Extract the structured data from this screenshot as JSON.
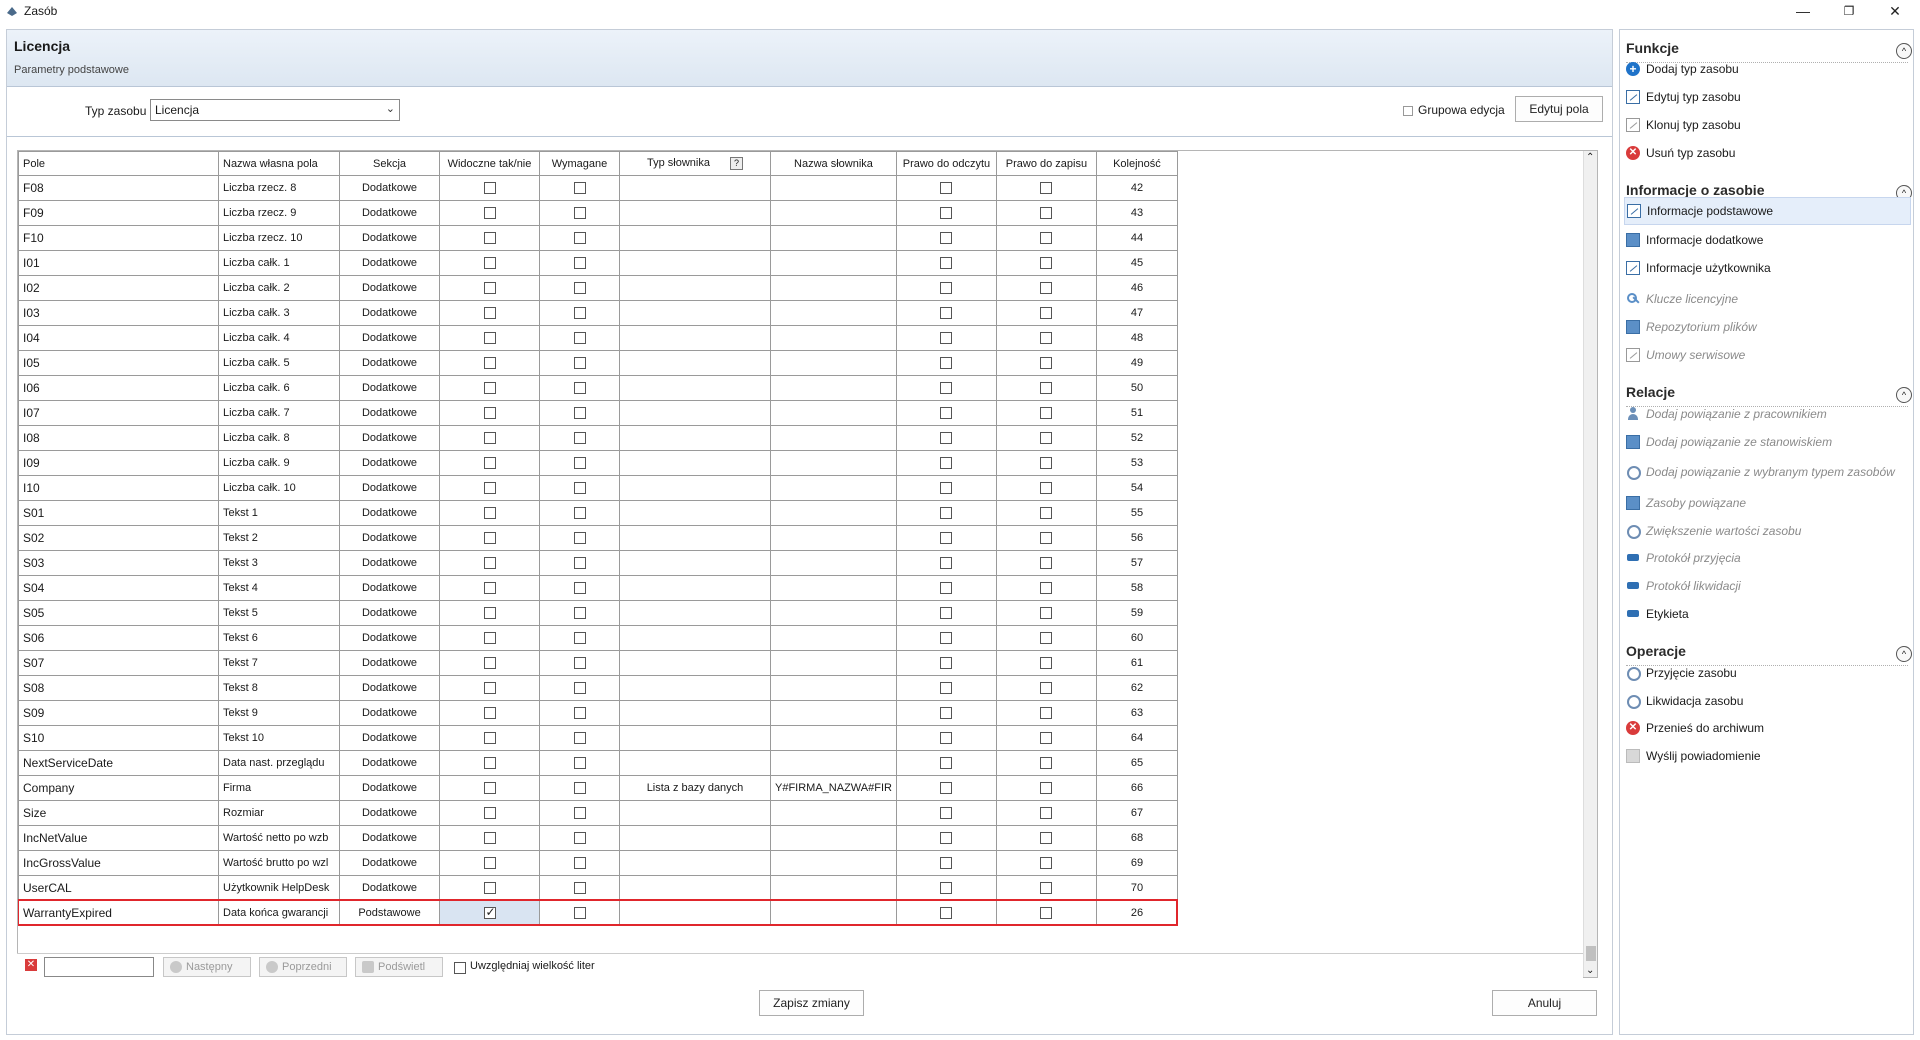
{
  "window": {
    "title": "Zasób",
    "minimize": "—",
    "restore": "❐",
    "close": "✕"
  },
  "header": {
    "title": "Licencja",
    "subtitle": "Parametry podstawowe"
  },
  "toolbar": {
    "typ_label": "Typ zasobu",
    "typ_value": "Licencja",
    "group_edit_label": "Grupowa edycja",
    "edit_fields_button": "Edytuj pola"
  },
  "grid": {
    "columns": [
      "Pole",
      "Nazwa własna pola",
      "Sekcja",
      "Widoczne tak/nie",
      "Wymagane",
      "Typ słownika",
      "Nazwa słownika",
      "Prawo do odczytu",
      "Prawo do zapisu",
      "Kolejność"
    ],
    "help_mark": "?",
    "rows": [
      {
        "pole": "F08",
        "nazwa": "Liczba rzecz. 8",
        "sekcja": "Dodatkowe",
        "widoczne": false,
        "wymagane": false,
        "typ": "",
        "slownik": "",
        "odczyt": false,
        "zapis": false,
        "kolejnosc": "42"
      },
      {
        "pole": "F09",
        "nazwa": "Liczba rzecz. 9",
        "sekcja": "Dodatkowe",
        "widoczne": false,
        "wymagane": false,
        "typ": "",
        "slownik": "",
        "odczyt": false,
        "zapis": false,
        "kolejnosc": "43"
      },
      {
        "pole": "F10",
        "nazwa": "Liczba rzecz. 10",
        "sekcja": "Dodatkowe",
        "widoczne": false,
        "wymagane": false,
        "typ": "",
        "slownik": "",
        "odczyt": false,
        "zapis": false,
        "kolejnosc": "44"
      },
      {
        "pole": "I01",
        "nazwa": "Liczba całk. 1",
        "sekcja": "Dodatkowe",
        "widoczne": false,
        "wymagane": false,
        "typ": "",
        "slownik": "",
        "odczyt": false,
        "zapis": false,
        "kolejnosc": "45"
      },
      {
        "pole": "I02",
        "nazwa": "Liczba całk. 2",
        "sekcja": "Dodatkowe",
        "widoczne": false,
        "wymagane": false,
        "typ": "",
        "slownik": "",
        "odczyt": false,
        "zapis": false,
        "kolejnosc": "46"
      },
      {
        "pole": "I03",
        "nazwa": "Liczba całk. 3",
        "sekcja": "Dodatkowe",
        "widoczne": false,
        "wymagane": false,
        "typ": "",
        "slownik": "",
        "odczyt": false,
        "zapis": false,
        "kolejnosc": "47"
      },
      {
        "pole": "I04",
        "nazwa": "Liczba całk. 4",
        "sekcja": "Dodatkowe",
        "widoczne": false,
        "wymagane": false,
        "typ": "",
        "slownik": "",
        "odczyt": false,
        "zapis": false,
        "kolejnosc": "48"
      },
      {
        "pole": "I05",
        "nazwa": "Liczba całk. 5",
        "sekcja": "Dodatkowe",
        "widoczne": false,
        "wymagane": false,
        "typ": "",
        "slownik": "",
        "odczyt": false,
        "zapis": false,
        "kolejnosc": "49"
      },
      {
        "pole": "I06",
        "nazwa": "Liczba całk. 6",
        "sekcja": "Dodatkowe",
        "widoczne": false,
        "wymagane": false,
        "typ": "",
        "slownik": "",
        "odczyt": false,
        "zapis": false,
        "kolejnosc": "50"
      },
      {
        "pole": "I07",
        "nazwa": "Liczba całk. 7",
        "sekcja": "Dodatkowe",
        "widoczne": false,
        "wymagane": false,
        "typ": "",
        "slownik": "",
        "odczyt": false,
        "zapis": false,
        "kolejnosc": "51"
      },
      {
        "pole": "I08",
        "nazwa": "Liczba całk. 8",
        "sekcja": "Dodatkowe",
        "widoczne": false,
        "wymagane": false,
        "typ": "",
        "slownik": "",
        "odczyt": false,
        "zapis": false,
        "kolejnosc": "52"
      },
      {
        "pole": "I09",
        "nazwa": "Liczba całk. 9",
        "sekcja": "Dodatkowe",
        "widoczne": false,
        "wymagane": false,
        "typ": "",
        "slownik": "",
        "odczyt": false,
        "zapis": false,
        "kolejnosc": "53"
      },
      {
        "pole": "I10",
        "nazwa": "Liczba całk. 10",
        "sekcja": "Dodatkowe",
        "widoczne": false,
        "wymagane": false,
        "typ": "",
        "slownik": "",
        "odczyt": false,
        "zapis": false,
        "kolejnosc": "54"
      },
      {
        "pole": "S01",
        "nazwa": "Tekst 1",
        "sekcja": "Dodatkowe",
        "widoczne": false,
        "wymagane": false,
        "typ": "",
        "slownik": "",
        "odczyt": false,
        "zapis": false,
        "kolejnosc": "55"
      },
      {
        "pole": "S02",
        "nazwa": "Tekst 2",
        "sekcja": "Dodatkowe",
        "widoczne": false,
        "wymagane": false,
        "typ": "",
        "slownik": "",
        "odczyt": false,
        "zapis": false,
        "kolejnosc": "56"
      },
      {
        "pole": "S03",
        "nazwa": "Tekst 3",
        "sekcja": "Dodatkowe",
        "widoczne": false,
        "wymagane": false,
        "typ": "",
        "slownik": "",
        "odczyt": false,
        "zapis": false,
        "kolejnosc": "57"
      },
      {
        "pole": "S04",
        "nazwa": "Tekst 4",
        "sekcja": "Dodatkowe",
        "widoczne": false,
        "wymagane": false,
        "typ": "",
        "slownik": "",
        "odczyt": false,
        "zapis": false,
        "kolejnosc": "58"
      },
      {
        "pole": "S05",
        "nazwa": "Tekst 5",
        "sekcja": "Dodatkowe",
        "widoczne": false,
        "wymagane": false,
        "typ": "",
        "slownik": "",
        "odczyt": false,
        "zapis": false,
        "kolejnosc": "59"
      },
      {
        "pole": "S06",
        "nazwa": "Tekst 6",
        "sekcja": "Dodatkowe",
        "widoczne": false,
        "wymagane": false,
        "typ": "",
        "slownik": "",
        "odczyt": false,
        "zapis": false,
        "kolejnosc": "60"
      },
      {
        "pole": "S07",
        "nazwa": "Tekst 7",
        "sekcja": "Dodatkowe",
        "widoczne": false,
        "wymagane": false,
        "typ": "",
        "slownik": "",
        "odczyt": false,
        "zapis": false,
        "kolejnosc": "61"
      },
      {
        "pole": "S08",
        "nazwa": "Tekst 8",
        "sekcja": "Dodatkowe",
        "widoczne": false,
        "wymagane": false,
        "typ": "",
        "slownik": "",
        "odczyt": false,
        "zapis": false,
        "kolejnosc": "62"
      },
      {
        "pole": "S09",
        "nazwa": "Tekst 9",
        "sekcja": "Dodatkowe",
        "widoczne": false,
        "wymagane": false,
        "typ": "",
        "slownik": "",
        "odczyt": false,
        "zapis": false,
        "kolejnosc": "63"
      },
      {
        "pole": "S10",
        "nazwa": "Tekst 10",
        "sekcja": "Dodatkowe",
        "widoczne": false,
        "wymagane": false,
        "typ": "",
        "slownik": "",
        "odczyt": false,
        "zapis": false,
        "kolejnosc": "64"
      },
      {
        "pole": "NextServiceDate",
        "nazwa": "Data nast. przeglądu",
        "sekcja": "Dodatkowe",
        "widoczne": false,
        "wymagane": false,
        "typ": "",
        "slownik": "",
        "odczyt": false,
        "zapis": false,
        "kolejnosc": "65"
      },
      {
        "pole": "Company",
        "nazwa": "Firma",
        "sekcja": "Dodatkowe",
        "widoczne": false,
        "wymagane": false,
        "typ": "Lista z bazy danych",
        "slownik": "Y#FIRMA_NAZWA#FIR",
        "odczyt": false,
        "zapis": false,
        "kolejnosc": "66"
      },
      {
        "pole": "Size",
        "nazwa": "Rozmiar",
        "sekcja": "Dodatkowe",
        "widoczne": false,
        "wymagane": false,
        "typ": "",
        "slownik": "",
        "odczyt": false,
        "zapis": false,
        "kolejnosc": "67"
      },
      {
        "pole": "IncNetValue",
        "nazwa": "Wartość netto po wzb",
        "sekcja": "Dodatkowe",
        "widoczne": false,
        "wymagane": false,
        "typ": "",
        "slownik": "",
        "odczyt": false,
        "zapis": false,
        "kolejnosc": "68"
      },
      {
        "pole": "IncGrossValue",
        "nazwa": "Wartość brutto po wzl",
        "sekcja": "Dodatkowe",
        "widoczne": false,
        "wymagane": false,
        "typ": "",
        "slownik": "",
        "odczyt": false,
        "zapis": false,
        "kolejnosc": "69"
      },
      {
        "pole": "UserCAL",
        "nazwa": "Użytkownik HelpDesk",
        "sekcja": "Dodatkowe",
        "widoczne": false,
        "wymagane": false,
        "typ": "",
        "slownik": "",
        "odczyt": false,
        "zapis": false,
        "kolejnosc": "70"
      },
      {
        "pole": "WarrantyExpired",
        "nazwa": "Data końca gwarancji",
        "sekcja": "Podstawowe",
        "widoczne": true,
        "wymagane": false,
        "typ": "",
        "slownik": "",
        "odczyt": false,
        "zapis": false,
        "kolejnosc": "26"
      }
    ]
  },
  "findbar": {
    "close": "✕",
    "next": "Następny",
    "prev": "Poprzedni",
    "highlight": "Podświetl",
    "case_label": "Uwzględniaj wielkość liter"
  },
  "footer": {
    "save": "Zapisz zmiany",
    "cancel": "Anuluj"
  },
  "sidebar": {
    "toggle": "^",
    "sections": [
      {
        "title": "Funkcje",
        "items": [
          {
            "label": "Dodaj typ zasobu",
            "icon": "plus-icon",
            "disabled": false
          },
          {
            "label": "Edytuj typ zasobu",
            "icon": "edit-icon",
            "disabled": false
          },
          {
            "label": "Klonuj typ zasobu",
            "icon": "clone-icon",
            "disabled": false
          },
          {
            "label": "Usuń typ zasobu",
            "icon": "delete-icon",
            "disabled": false
          }
        ]
      },
      {
        "title": "Informacje o zasobie",
        "items": [
          {
            "label": "Informacje podstawowe",
            "icon": "info-icon",
            "disabled": false,
            "active": true
          },
          {
            "label": "Informacje dodatkowe",
            "icon": "info-extra-icon",
            "disabled": false
          },
          {
            "label": "Informacje użytkownika",
            "icon": "user-info-icon",
            "disabled": false
          },
          {
            "label": "Klucze licencyjne",
            "icon": "key-icon",
            "disabled": true
          },
          {
            "label": "Repozytorium plików",
            "icon": "repository-icon",
            "disabled": true
          },
          {
            "label": "Umowy serwisowe",
            "icon": "contract-icon",
            "disabled": true
          }
        ]
      },
      {
        "title": "Relacje",
        "items": [
          {
            "label": "Dodaj powiązanie z pracownikiem",
            "icon": "person-link-icon",
            "disabled": true
          },
          {
            "label": "Dodaj powiązanie ze stanowiskiem",
            "icon": "workstation-link-icon",
            "disabled": true
          },
          {
            "label": "Dodaj powiązanie z wybranym typem zasobów",
            "icon": "type-link-icon",
            "disabled": true
          },
          {
            "label": "Zasoby powiązane",
            "icon": "related-icon",
            "disabled": true
          },
          {
            "label": "Zwiększenie wartości zasobu",
            "icon": "value-up-icon",
            "disabled": true
          },
          {
            "label": "Protokół przyjęcia",
            "icon": "protocol-in-icon",
            "disabled": true
          },
          {
            "label": "Protokół likwidacji",
            "icon": "protocol-out-icon",
            "disabled": true
          },
          {
            "label": "Etykieta",
            "icon": "label-icon",
            "disabled": false
          }
        ]
      },
      {
        "title": "Operacje",
        "items": [
          {
            "label": "Przyjęcie zasobu",
            "icon": "accept-icon",
            "disabled": false
          },
          {
            "label": "Likwidacja zasobu",
            "icon": "liquidate-icon",
            "disabled": false
          },
          {
            "label": "Przenieś do archiwum",
            "icon": "archive-icon",
            "disabled": false
          },
          {
            "label": "Wyślij powiadomienie",
            "icon": "notify-icon",
            "disabled": false
          }
        ]
      }
    ]
  }
}
